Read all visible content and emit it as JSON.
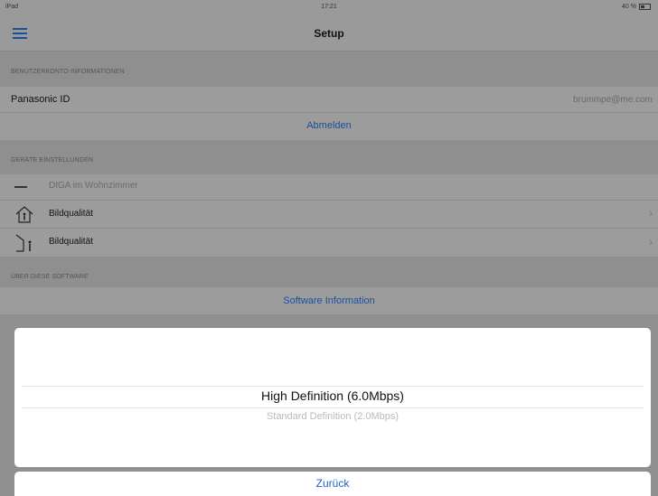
{
  "status_bar": {
    "left": "iPad",
    "time": "17:21",
    "battery": "40 %"
  },
  "header": {
    "title": "Setup",
    "menu_icon": "menu-icon"
  },
  "account": {
    "section_title": "BENUTZERKONTO-INFORMATIONEN",
    "panasonic_label": "Panasonic ID",
    "panasonic_value": "brummpe@me.com",
    "logout_label": "Abmelden"
  },
  "device": {
    "section_title": "GERÄTE EINSTELLUNGEN",
    "device_name": "DIGA im Wohnzimmer",
    "items": [
      {
        "label": "Bildqualität",
        "icon": "home-icon"
      },
      {
        "label": "Bildqualität",
        "icon": "person-outside-icon"
      }
    ]
  },
  "about": {
    "section_title": "ÜBER DIESE SOFTWARE",
    "software_info_label": "Software Information"
  },
  "picker": {
    "options": [
      "High Definition (6.0Mbps)",
      "Standard Definition (2.0Mbps)"
    ],
    "selected": "High Definition (6.0Mbps)"
  },
  "back_button": {
    "label": "Zurück"
  },
  "colors": {
    "link": "#1b4f9e",
    "back_link": "#1f62c6",
    "dim_background": "#8f8f8f"
  }
}
